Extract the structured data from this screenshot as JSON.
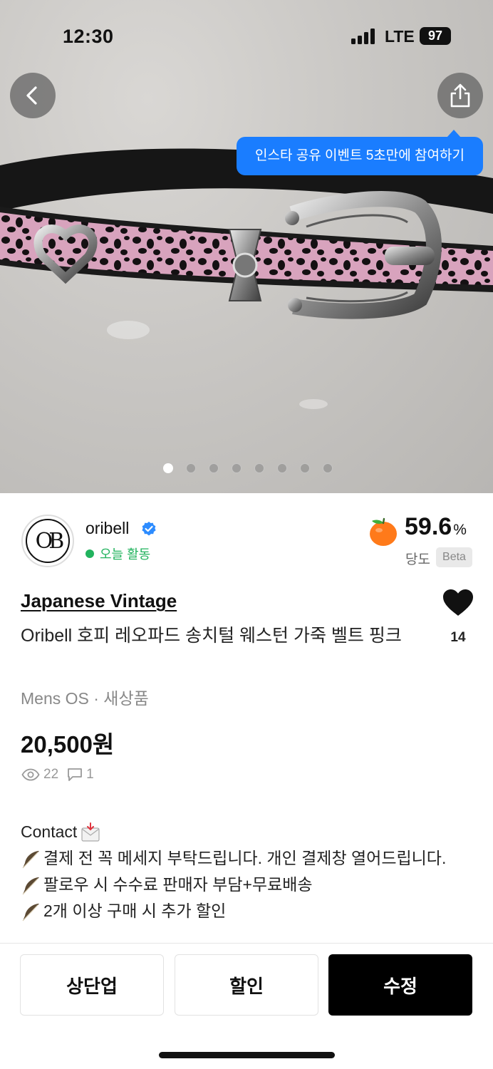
{
  "status_bar": {
    "time": "12:30",
    "network": "LTE",
    "battery": "97"
  },
  "hero": {
    "image_alt": "pink leopard calf-hair western leather belt with silver buckle",
    "tooltip": "인스타 공유 이벤트 5초만에 참여하기",
    "page_count": 8,
    "current_page": 1
  },
  "seller": {
    "avatar_text": "OB",
    "name": "oribell",
    "verified": true,
    "activity": "오늘 활동",
    "activity_color": "#22b35e"
  },
  "sweetness": {
    "value": "59.6",
    "unit": "%",
    "label": "당도",
    "badge": "Beta"
  },
  "product": {
    "brand": "Japanese Vintage",
    "title": "Oribell 호피 레오파드 송치털 웨스턴 가죽 벨트 핑크",
    "meta": "Mens OS · 새상품",
    "price": "20,500원",
    "likes": "14",
    "views": "22",
    "comments": "1"
  },
  "description": {
    "contact": "Contact",
    "lines": [
      "결제 전 꼭 메세지 부탁드립니다. 개인 결제창 열어드립니다.",
      "팔로우 시 수수료 판매자 부담+무료배송",
      "2개 이상 구매 시 추가 할인"
    ]
  },
  "actions": {
    "bump": "상단업",
    "discount": "할인",
    "edit": "수정"
  },
  "colors": {
    "accent_blue": "#1a7dff",
    "primary": "#000000",
    "belt_pink": "#d8a3bd"
  }
}
